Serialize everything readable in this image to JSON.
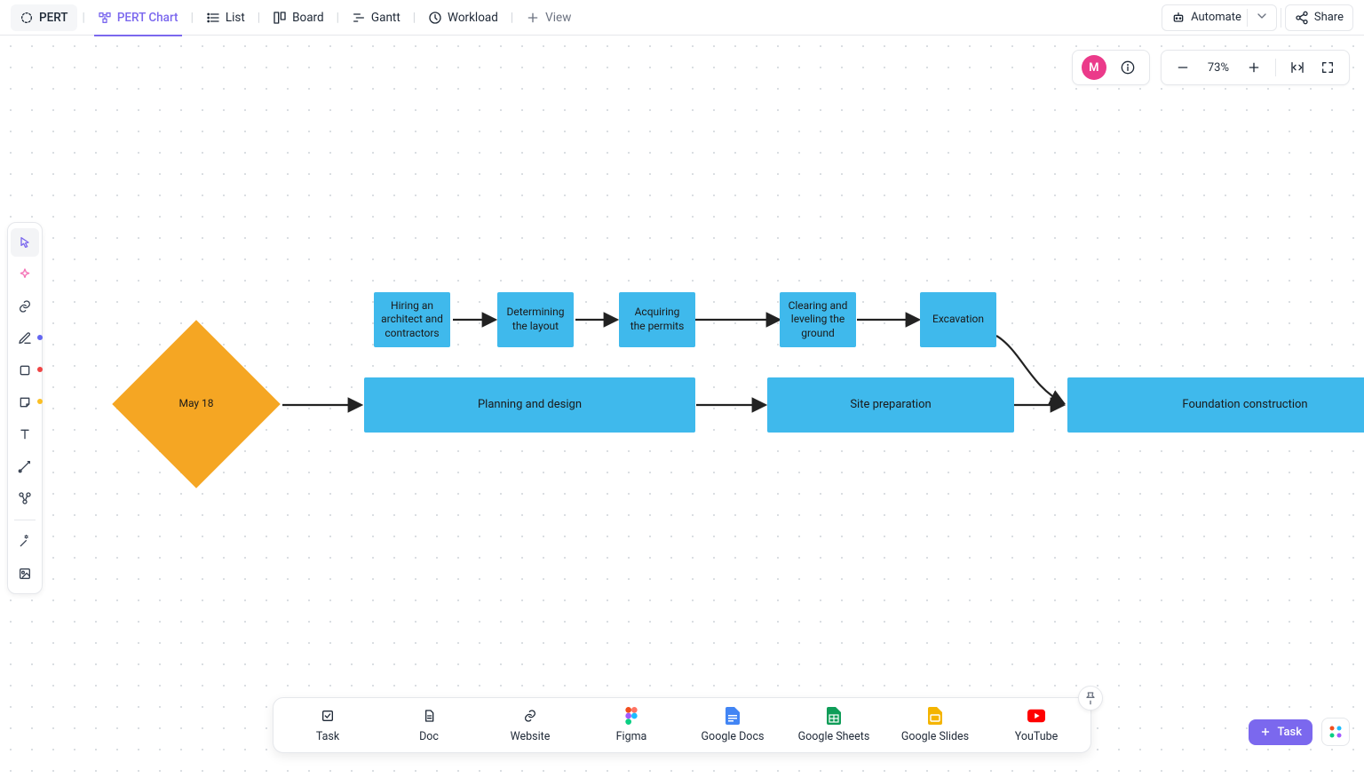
{
  "app_name": "PERT",
  "views": {
    "pert_chart": "PERT Chart",
    "list": "List",
    "board": "Board",
    "gantt": "Gantt",
    "workload": "Workload",
    "add": "View"
  },
  "automate_label": "Automate",
  "share_label": "Share",
  "zoom_percent": "73%",
  "avatar_letter": "M",
  "dock": {
    "task": "Task",
    "doc": "Doc",
    "website": "Website",
    "figma": "Figma",
    "google_docs": "Google Docs",
    "google_sheets": "Google Sheets",
    "google_slides": "Google Slides",
    "youtube": "YouTube"
  },
  "task_button": "Task",
  "nodes": {
    "start_date": "May 18",
    "hiring": "Hiring an architect and contractors",
    "layout": "Determining the layout",
    "permits": "Acquiring the permits",
    "clearing": "Clearing and leveling the ground",
    "excavation": "Excavation",
    "planning": "Planning and design",
    "siteprep": "Site preparation",
    "foundation": "Foundation construction"
  }
}
